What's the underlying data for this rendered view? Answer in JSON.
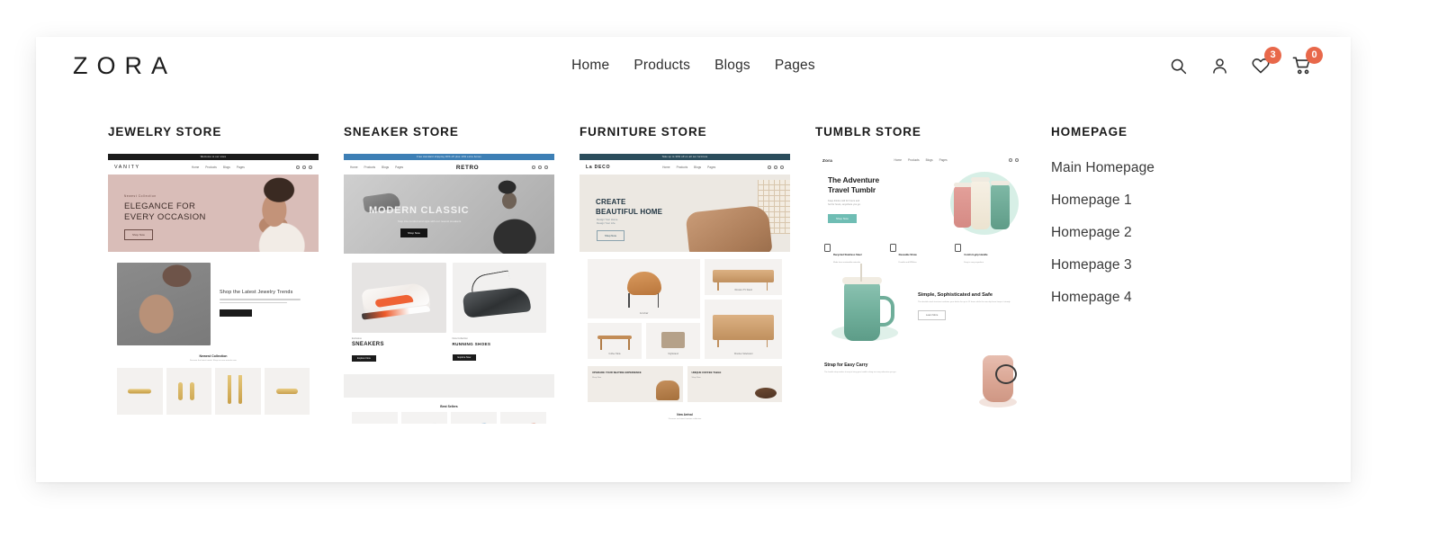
{
  "header": {
    "logo": "ZORA",
    "nav": [
      {
        "label": "Home"
      },
      {
        "label": "Products"
      },
      {
        "label": "Blogs"
      },
      {
        "label": "Pages"
      }
    ],
    "icons": {
      "search": "search-icon",
      "account": "user-icon",
      "wishlist": "heart-icon",
      "cart": "cart-icon"
    },
    "wishlist_count": "3",
    "cart_count": "0",
    "badge_color": "#e8684a"
  },
  "mega_menu": {
    "columns": [
      {
        "title": "JEWELRY STORE"
      },
      {
        "title": "SNEAKER STORE"
      },
      {
        "title": "FURNITURE STORE"
      },
      {
        "title": "TUMBLR STORE"
      }
    ],
    "homepage": {
      "title": "HOMEPAGE",
      "links": [
        {
          "label": "Main Homepage"
        },
        {
          "label": "Homepage 1"
        },
        {
          "label": "Homepage 2"
        },
        {
          "label": "Homepage 3"
        },
        {
          "label": "Homepage 4"
        }
      ]
    }
  },
  "previews": {
    "jewelry": {
      "announcement": "Welcome to our store",
      "brand": "VANITY",
      "nav": [
        "Home",
        "Products",
        "Blogs",
        "Pages"
      ],
      "eyebrow": "Newest Collection",
      "headline_line1": "ELEGANCE FOR",
      "headline_line2": "EVERY OCCASION",
      "cta": "Shop Now",
      "section2_title": "Shop the Latest Jewelry Trends",
      "section2_cta": "Read More",
      "section3_title": "Newest Collection",
      "section3_subtitle": "Discover the latest trends. Shop our new arrivals now."
    },
    "sneaker": {
      "announcement": "Free standard shipping 30% off plus 10% extra bonus",
      "brand": "RETRO",
      "nav": [
        "Home",
        "Products",
        "Blogs",
        "Pages"
      ],
      "headline": "MODERN CLASSIC",
      "subtitle": "Step into comfort and style with our newest sneakers",
      "cta": "Shop Now",
      "card1_eyebrow": "Exclusive",
      "card1_title": "SNEAKERS",
      "card1_cta": "Explore Now",
      "card2_eyebrow": "New Collection",
      "card2_title": "RUNNING SHOES",
      "card2_cta": "Explore Now",
      "bestsellers_title": "Best Sellers"
    },
    "furniture": {
      "announcement": "Take up to 30% off on all our furniture",
      "brand": "La DECO",
      "nav": [
        "Home",
        "Products",
        "Blogs",
        "Pages"
      ],
      "headline_line1": "CREATE",
      "headline_line2": "BEAUTIFUL HOME",
      "subtitle_line1": "Design Your Home.",
      "subtitle_line2": "Design Your Life.",
      "cta": "Shop Now",
      "items": [
        {
          "caption": "Armchair"
        },
        {
          "caption": "Wooden TV Stand"
        },
        {
          "caption": "Wooden Sideboard"
        },
        {
          "caption": "Coffee Table"
        },
        {
          "caption": "Nightstand"
        }
      ],
      "promo1_title": "UPGRADE YOUR SEATING EXPERIENCE",
      "promo1_cta": "Shop Now",
      "promo2_title": "UNIQUE COFFEE TABLE",
      "promo2_cta": "Shop Now",
      "newarrival_title": "New Arrival",
      "newarrival_subtitle": "Discover our latest furniture collection"
    },
    "tumblr": {
      "brand": "Zora",
      "nav": [
        "Home",
        "Products",
        "Blogs",
        "Pages"
      ],
      "headline_line1": "The Adventure",
      "headline_line2": "Travel Tumblr",
      "subtitle_line1": "Keep drinks cold for hours and",
      "subtitle_line2": "hot for hours, anywhere you go.",
      "cta": "Shop Now",
      "features": [
        {
          "title": "Recycled Stainless Steel",
          "subtitle": "Made from sustainable materials"
        },
        {
          "title": "Reusable Straw",
          "subtitle": "Durable and BPA free"
        },
        {
          "title": "Comfort-grip Handle",
          "subtitle": "Easy to carry anywhere"
        }
      ],
      "section2_title": "Simple, Sophisticated and Safe",
      "section2_body": "The durable steel structure insulates your drinks for up to 12 hours while the non-slip base keeps it steady.",
      "section2_cta": "Learn More",
      "section3_title": "Strap for Easy Carry",
      "section3_body": "The handle strap makes it easy to bring your tumbler along on every adventure you go."
    }
  }
}
